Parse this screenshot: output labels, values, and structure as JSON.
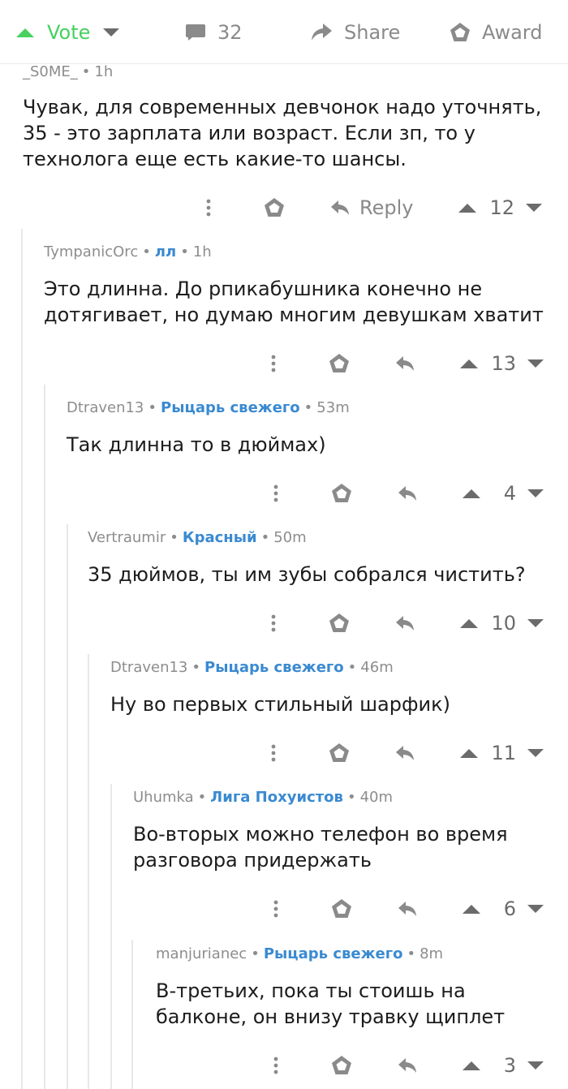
{
  "toolbar": {
    "vote_label": "Vote",
    "comments_count": "32",
    "share_label": "Share",
    "award_label": "Award",
    "accent_color": "#46d160"
  },
  "comments": [
    {
      "author": "_S0ME_",
      "flair": "",
      "time": "1h",
      "text": "Чувак, для современных девчонок надо уточнять, 35 - это зарплата или возраст. Если зп, то у технолога еще есть какие-то шансы.",
      "reply_label": "Reply",
      "score": "12"
    },
    {
      "author": "TympanicOrc",
      "flair": "лл",
      "time": "1h",
      "text": "Это длинна. До рпикабушника конечно не дотягивает, но думаю многим девушкам хватит",
      "score": "13"
    },
    {
      "author": "Dtraven13",
      "flair": "Рыцарь свежего",
      "time": "53m",
      "text": "Так длинна то в дюймах)",
      "score": "4"
    },
    {
      "author": "Vertraumir",
      "flair": "Красный",
      "time": "50m",
      "text": "35 дюймов, ты им зубы собрался чистить?",
      "score": "10"
    },
    {
      "author": "Dtraven13",
      "flair": "Рыцарь свежего",
      "time": "46m",
      "text": "Ну во первых стильный шарфик)",
      "score": "11"
    },
    {
      "author": "Uhumka",
      "flair": "Лига Похуистов",
      "time": "40m",
      "text": "Во-вторых можно телефон во время разговора придержать",
      "score": "6"
    },
    {
      "author": "manjurianec",
      "flair": "Рыцарь свежего",
      "time": "8m",
      "text": "В-третьих, пока ты стоишь на балконе, он внизу травку щиплет",
      "score": "3"
    }
  ],
  "icons": {
    "vote_up": "vote-up-icon",
    "vote_down": "vote-down-icon",
    "comment": "comment-bubble-icon",
    "share": "share-arrow-icon",
    "award": "award-icon",
    "more": "more-vertical-icon",
    "reply": "reply-arrow-icon",
    "upvote": "upvote-icon",
    "downvote": "downvote-icon"
  }
}
